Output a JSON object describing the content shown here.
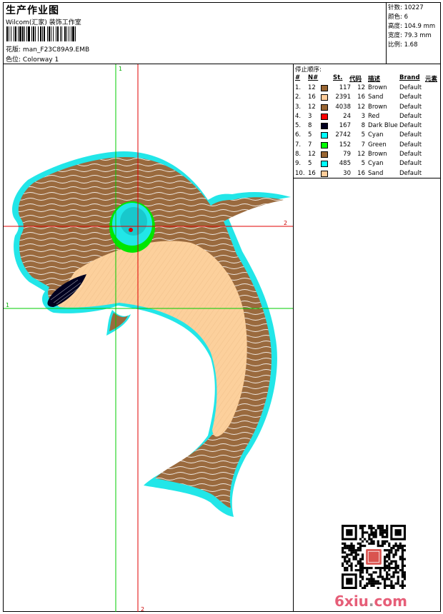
{
  "header": {
    "title": "生产作业图",
    "company": "Wilcom(汇家) 装饰工作室",
    "design_label": "花版:",
    "design_value": "man_F23C89A9.EMB",
    "colorway_label": "色位:",
    "colorway_value": "Colorway 1"
  },
  "stats": {
    "stitches": "针数: 10227",
    "colors": "颜色: 6",
    "height": "高度: 104.9 mm",
    "width": "宽度: 79.3 mm",
    "ratio": "比例: 1.68"
  },
  "stop_sequence": {
    "title": "停止顺序:",
    "headers": {
      "num": "#",
      "n": "N#",
      "st": "St.",
      "code": "代码",
      "desc": "描述",
      "brand": "Brand",
      "elem": "元素"
    },
    "rows": [
      {
        "num": "1.",
        "n": "12",
        "color": "#996633",
        "st": "117",
        "code": "12",
        "desc": "Brown",
        "brand": "Default"
      },
      {
        "num": "2.",
        "n": "16",
        "color": "#ffcc99",
        "st": "2391",
        "code": "16",
        "desc": "Sand",
        "brand": "Default"
      },
      {
        "num": "3.",
        "n": "12",
        "color": "#996633",
        "st": "4038",
        "code": "12",
        "desc": "Brown",
        "brand": "Default"
      },
      {
        "num": "4.",
        "n": "3",
        "color": "#ff0000",
        "st": "24",
        "code": "3",
        "desc": "Red",
        "brand": "Default"
      },
      {
        "num": "5.",
        "n": "8",
        "color": "#000020",
        "st": "167",
        "code": "8",
        "desc": "Dark Blue",
        "brand": "Default"
      },
      {
        "num": "6.",
        "n": "5",
        "color": "#00ffff",
        "st": "2742",
        "code": "5",
        "desc": "Cyan",
        "brand": "Default"
      },
      {
        "num": "7.",
        "n": "7",
        "color": "#00ff00",
        "st": "152",
        "code": "7",
        "desc": "Green",
        "brand": "Default"
      },
      {
        "num": "8.",
        "n": "12",
        "color": "#996633",
        "st": "79",
        "code": "12",
        "desc": "Brown",
        "brand": "Default"
      },
      {
        "num": "9.",
        "n": "5",
        "color": "#00ffff",
        "st": "485",
        "code": "5",
        "desc": "Cyan",
        "brand": "Default"
      },
      {
        "num": "10.",
        "n": "16",
        "color": "#ffcc99",
        "st": "30",
        "code": "16",
        "desc": "Sand",
        "brand": "Default"
      }
    ]
  },
  "guides": {
    "v1": "1",
    "v2": "2",
    "h1": "1",
    "h2": "2"
  },
  "watermark": {
    "main": "6xiu",
    "dot": ".",
    "ext": "com"
  },
  "colors": {
    "brown": "#9a6a3e",
    "sand": "#fcd09c",
    "cyan": "#22e6e8",
    "green_guide": "#00cc00",
    "red_guide": "#e00000"
  }
}
